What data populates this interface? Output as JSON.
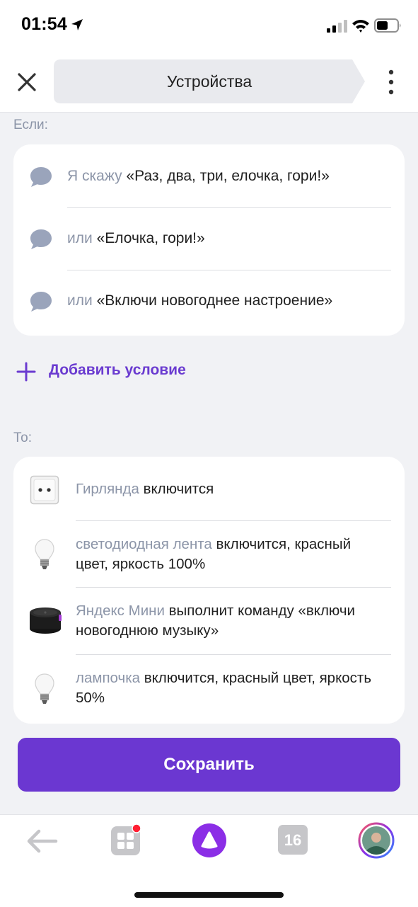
{
  "status_bar": {
    "time": "01:54",
    "icons": [
      "location-arrow-icon",
      "cellular-signal-icon",
      "wifi-icon",
      "battery-icon"
    ]
  },
  "header": {
    "title": "Устройства",
    "close_icon": "close-icon",
    "more_icon": "more-vertical-icon"
  },
  "conditions": {
    "label": "Если:",
    "items": [
      {
        "prefix": "Я скажу",
        "phrase": "«Раз, два, три, елочка, гори!»"
      },
      {
        "prefix": "или",
        "phrase": "«Елочка, гори!»"
      },
      {
        "prefix": "или",
        "phrase": "«Включи новогоднее настроение»"
      }
    ],
    "add_label": "Добавить условие"
  },
  "actions": {
    "label": "То:",
    "items": [
      {
        "device": "Гирлянда",
        "text": "включится",
        "icon": "socket-icon"
      },
      {
        "device": "светодиодная лента",
        "text": "включится, красный цвет, яркость 100%",
        "icon": "light-bulb-icon"
      },
      {
        "device": "Яндекс Мини",
        "text": "выполнит команду «включи новогоднюю музыку»",
        "icon": "smart-speaker-icon"
      },
      {
        "device": "лампочка",
        "text": "включится, красный цвет, яркость 50%",
        "icon": "light-bulb-icon"
      }
    ]
  },
  "save_button": {
    "label": "Сохранить"
  },
  "bottom_nav": {
    "calendar_day": "16",
    "items": [
      "back-arrow-icon",
      "services-grid-icon",
      "alice-icon",
      "calendar-icon",
      "profile-avatar"
    ],
    "notification_badge_color": "#ff1f33"
  },
  "colors": {
    "accent": "#6b37d1",
    "muted_text": "#8c95a8",
    "background": "#f1f2f5"
  }
}
